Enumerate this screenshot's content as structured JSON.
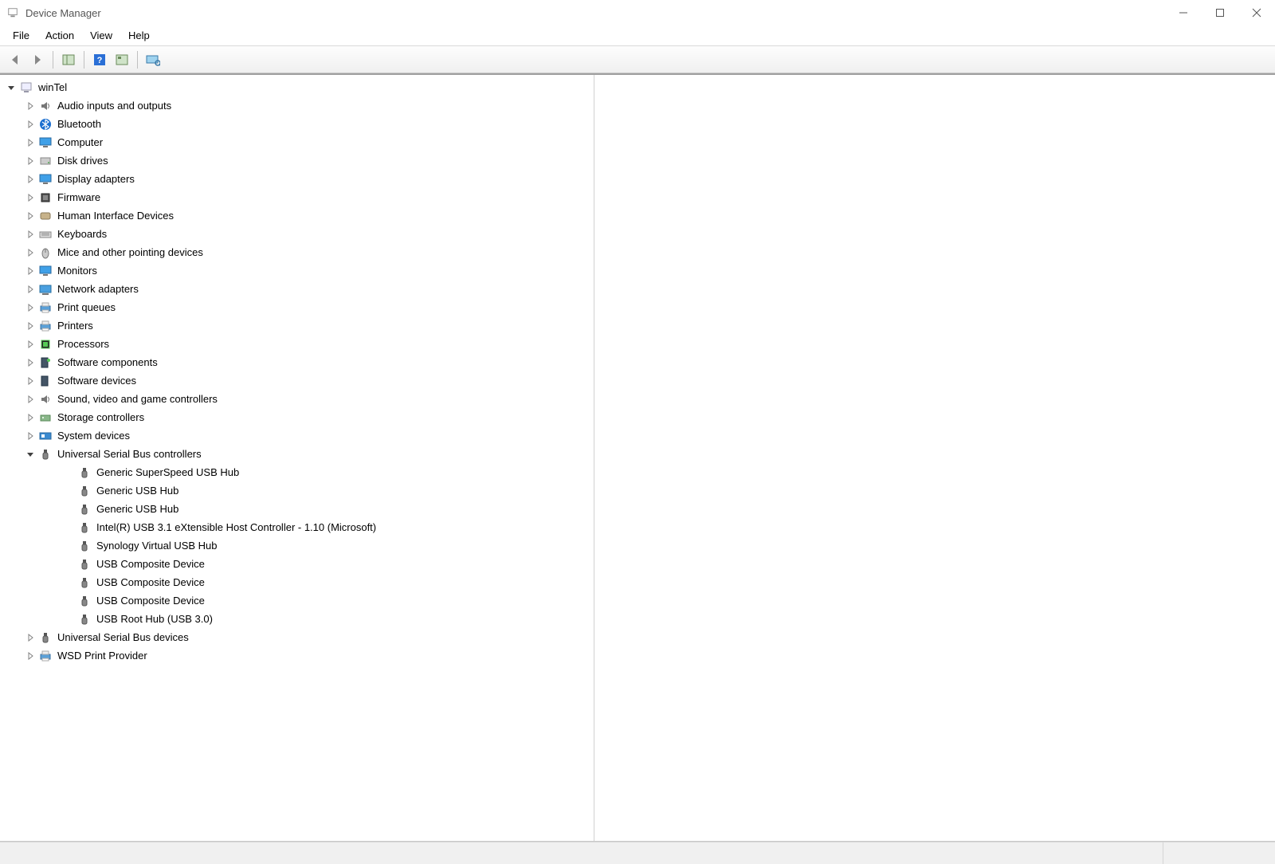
{
  "window": {
    "title": "Device Manager"
  },
  "menu": {
    "items": [
      "File",
      "Action",
      "View",
      "Help"
    ]
  },
  "toolbar": {
    "buttons": [
      {
        "name": "back-button",
        "icon": "arrow-left-icon"
      },
      {
        "name": "forward-button",
        "icon": "arrow-right-icon"
      },
      {
        "sep": true
      },
      {
        "name": "show-hide-tree-button",
        "icon": "tree-pane-icon"
      },
      {
        "sep": true
      },
      {
        "name": "help-button",
        "icon": "help-icon"
      },
      {
        "name": "properties-button",
        "icon": "properties-icon"
      },
      {
        "sep": true
      },
      {
        "name": "scan-hardware-button",
        "icon": "scan-icon"
      }
    ]
  },
  "tree": {
    "root": {
      "label": "winTel",
      "icon": "computer-root-icon",
      "expanded": true,
      "categories": [
        {
          "label": "Audio inputs and outputs",
          "icon": "speaker-icon",
          "expanded": false
        },
        {
          "label": "Bluetooth",
          "icon": "bluetooth-icon",
          "expanded": false
        },
        {
          "label": "Computer",
          "icon": "computer-icon",
          "expanded": false
        },
        {
          "label": "Disk drives",
          "icon": "disk-icon",
          "expanded": false
        },
        {
          "label": "Display adapters",
          "icon": "display-icon",
          "expanded": false
        },
        {
          "label": "Firmware",
          "icon": "firmware-icon",
          "expanded": false
        },
        {
          "label": "Human Interface Devices",
          "icon": "hid-icon",
          "expanded": false
        },
        {
          "label": "Keyboards",
          "icon": "keyboard-icon",
          "expanded": false
        },
        {
          "label": "Mice and other pointing devices",
          "icon": "mouse-icon",
          "expanded": false
        },
        {
          "label": "Monitors",
          "icon": "monitor-icon",
          "expanded": false
        },
        {
          "label": "Network adapters",
          "icon": "network-icon",
          "expanded": false
        },
        {
          "label": "Print queues",
          "icon": "printer-icon",
          "expanded": false
        },
        {
          "label": "Printers",
          "icon": "printer-icon",
          "expanded": false
        },
        {
          "label": "Processors",
          "icon": "processor-icon",
          "expanded": false
        },
        {
          "label": "Software components",
          "icon": "software-comp-icon",
          "expanded": false
        },
        {
          "label": "Software devices",
          "icon": "software-dev-icon",
          "expanded": false
        },
        {
          "label": "Sound, video and game controllers",
          "icon": "speaker-icon",
          "expanded": false
        },
        {
          "label": "Storage controllers",
          "icon": "storage-icon",
          "expanded": false
        },
        {
          "label": "System devices",
          "icon": "system-icon",
          "expanded": false
        },
        {
          "label": "Universal Serial Bus controllers",
          "icon": "usb-icon",
          "expanded": true,
          "children": [
            {
              "label": "Generic SuperSpeed USB Hub",
              "icon": "usb-icon"
            },
            {
              "label": "Generic USB Hub",
              "icon": "usb-icon"
            },
            {
              "label": "Generic USB Hub",
              "icon": "usb-icon"
            },
            {
              "label": "Intel(R) USB 3.1 eXtensible Host Controller - 1.10 (Microsoft)",
              "icon": "usb-icon"
            },
            {
              "label": "Synology Virtual USB Hub",
              "icon": "usb-icon"
            },
            {
              "label": "USB Composite Device",
              "icon": "usb-icon"
            },
            {
              "label": "USB Composite Device",
              "icon": "usb-icon"
            },
            {
              "label": "USB Composite Device",
              "icon": "usb-icon"
            },
            {
              "label": "USB Root Hub (USB 3.0)",
              "icon": "usb-icon"
            }
          ]
        },
        {
          "label": "Universal Serial Bus devices",
          "icon": "usb-icon",
          "expanded": false
        },
        {
          "label": "WSD Print Provider",
          "icon": "printer-icon",
          "expanded": false
        }
      ]
    }
  },
  "icons": {
    "computer-root-icon": "🖥",
    "speaker-icon": "🔊",
    "bluetooth-icon": "BT",
    "computer-icon": "🖥",
    "disk-icon": "💽",
    "display-icon": "🖥",
    "firmware-icon": "🧱",
    "hid-icon": "🎮",
    "keyboard-icon": "⌨",
    "mouse-icon": "🖱",
    "monitor-icon": "🖥",
    "network-icon": "🌐",
    "printer-icon": "🖨",
    "processor-icon": "▢",
    "software-comp-icon": "🧩",
    "software-dev-icon": "📦",
    "storage-icon": "💾",
    "system-icon": "🗂",
    "usb-icon": "ψ"
  }
}
